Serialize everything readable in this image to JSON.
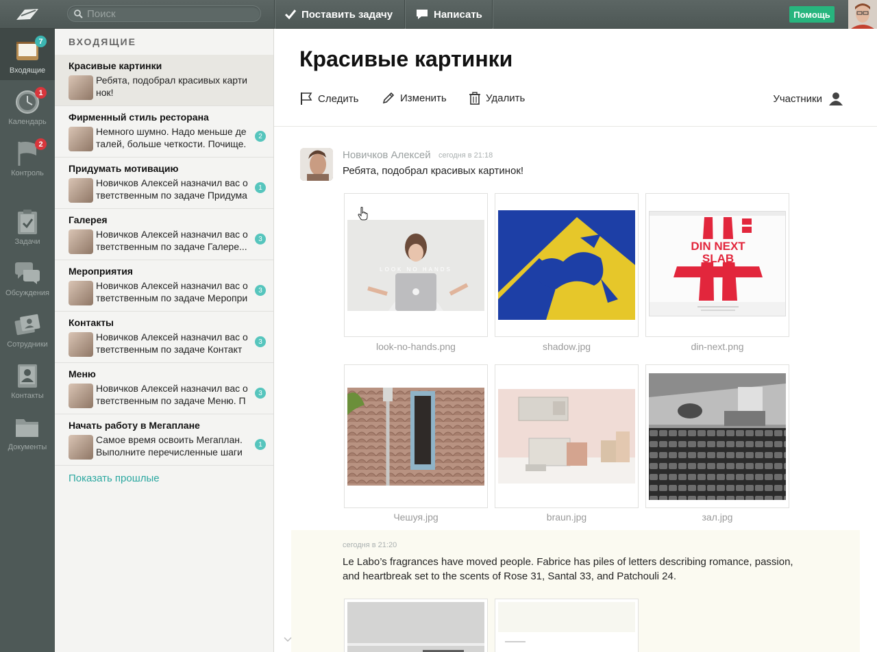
{
  "topbar": {
    "search_placeholder": "Поиск",
    "task_button": "Поставить задачу",
    "write_button": "Написать",
    "help_button": "Помощь"
  },
  "rail": {
    "items": [
      {
        "label": "Входящие",
        "badge": "7",
        "icon": "inbox-icon"
      },
      {
        "label": "Календарь",
        "badge": "1",
        "icon": "clock-icon"
      },
      {
        "label": "Контроль",
        "badge": "2",
        "icon": "flag-icon"
      },
      {
        "label": "Задачи",
        "icon": "clipboard-icon"
      },
      {
        "label": "Обсуждения",
        "icon": "chat-icon"
      },
      {
        "label": "Сотрудники",
        "icon": "people-icon"
      },
      {
        "label": "Контакты",
        "icon": "contact-icon"
      },
      {
        "label": "Документы",
        "icon": "folder-icon"
      }
    ]
  },
  "inbox": {
    "title": "ВХОДЯЩИЕ",
    "items": [
      {
        "title": "Красивые картинки",
        "text": "Ребята, подобрал красивых карти нок!",
        "count": ""
      },
      {
        "title": "Фирменный стиль ресторана",
        "text": "Немного шумно. Надо меньше де талей, больше четкости. Почище.",
        "count": "2"
      },
      {
        "title": "Придумать мотивацию",
        "text": "Новичков Алексей назначил вас о тветственным по задаче Придума",
        "count": "1"
      },
      {
        "title": "Галерея",
        "text": "Новичков Алексей назначил вас о тветственным по задаче Галере...",
        "count": "3"
      },
      {
        "title": "Мероприятия",
        "text": "Новичков Алексей назначил вас о тветственным по задаче Меропри",
        "count": "3"
      },
      {
        "title": "Контакты",
        "text": "Новичков Алексей назначил вас о тветственным по задаче Контакт",
        "count": "3"
      },
      {
        "title": "Меню",
        "text": "Новичков Алексей назначил вас о тветственным по задаче Меню. П",
        "count": "3"
      },
      {
        "title": "Начать работу в Мегаплане",
        "text": "Самое время освоить Мегаплан. Выполните перечисленные шаги",
        "count": "1"
      }
    ],
    "show_past": "Показать прошлые"
  },
  "main": {
    "title": "Красивые картинки",
    "actions": {
      "follow": "Следить",
      "edit": "Изменить",
      "delete": "Удалить",
      "participants": "Участники"
    },
    "post1": {
      "author": "Новичков Алексей",
      "time": "сегодня в 21:18",
      "text": "Ребята, подобрал красивых картинок!",
      "attachments": [
        {
          "name": "look-no-hands.png",
          "overlay": "LOOK NO HANDS"
        },
        {
          "name": "shadow.jpg"
        },
        {
          "name": "din-next.png",
          "overlay_line1": "DIN NEXT",
          "overlay_line2": "SLAB"
        },
        {
          "name": "Чешуя.jpg"
        },
        {
          "name": "braun.jpg"
        },
        {
          "name": "зал.jpg"
        }
      ]
    },
    "post2": {
      "time": "сегодня в 21:20",
      "text": "Le Labo’s fragrances have moved people. Fabrice has piles of letters describing romance, passion, and heartbreak set to the scents of Rose 31, Santal 33, and Patchouli 24."
    }
  },
  "colors": {
    "accent": "#2aa7a0",
    "help_green": "#27b57e",
    "badge_red": "#d9363c",
    "badge_teal": "#3bb6b2"
  }
}
